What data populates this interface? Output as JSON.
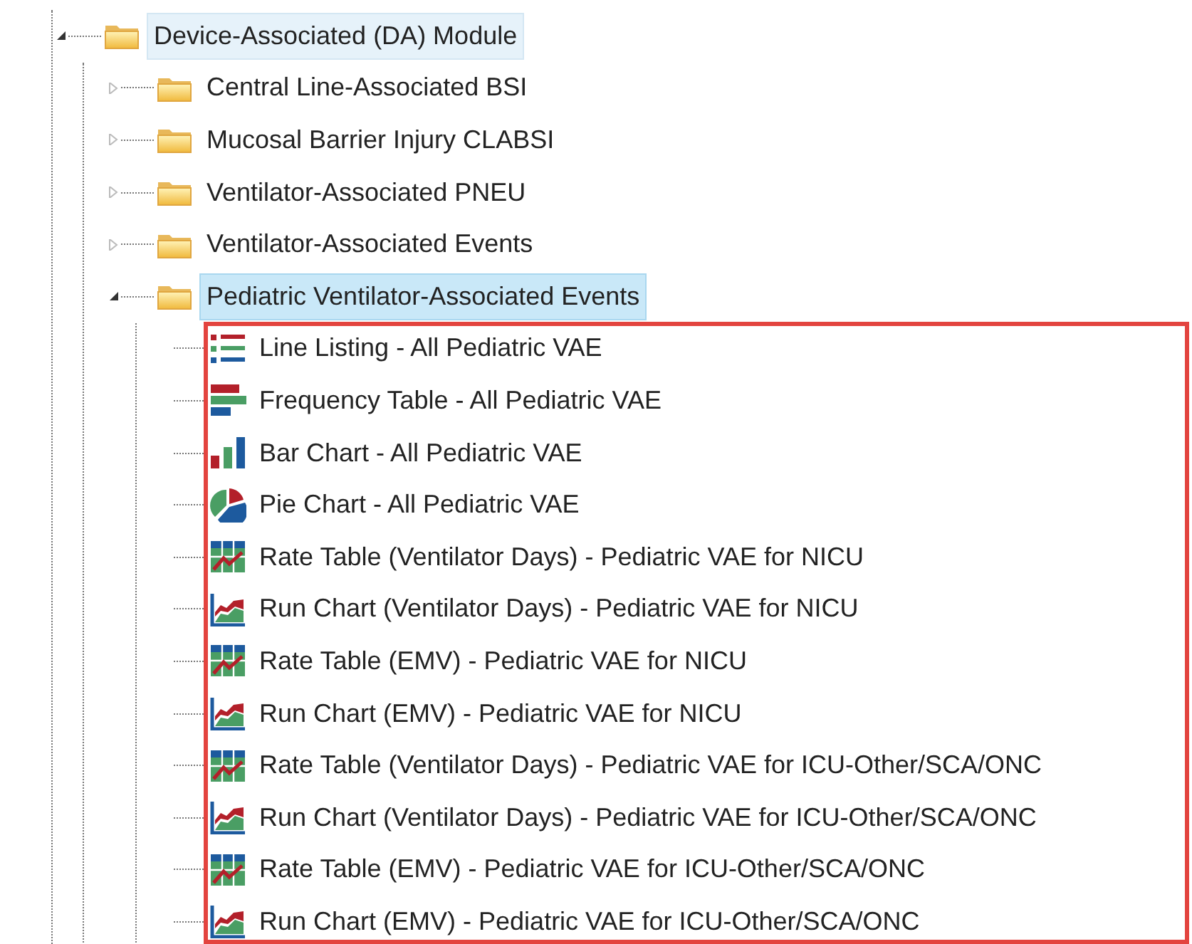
{
  "tree": [
    {
      "label": "Device-Associated (DA) Module",
      "kind": "folder",
      "expanded": true,
      "selected": false,
      "hovered": true,
      "children": [
        {
          "label": "Central Line-Associated BSI",
          "kind": "folder",
          "expanded": false,
          "selected": false,
          "hovered": false
        },
        {
          "label": "Mucosal Barrier Injury CLABSI",
          "kind": "folder",
          "expanded": false,
          "selected": false,
          "hovered": false
        },
        {
          "label": "Ventilator-Associated PNEU",
          "kind": "folder",
          "expanded": false,
          "selected": false,
          "hovered": false
        },
        {
          "label": "Ventilator-Associated Events",
          "kind": "folder",
          "expanded": false,
          "selected": false,
          "hovered": false
        },
        {
          "label": "Pediatric Ventilator-Associated Events",
          "kind": "folder",
          "expanded": true,
          "selected": true,
          "hovered": false,
          "outlined": true,
          "children": [
            {
              "label": "Line Listing - All Pediatric VAE",
              "kind": "listing"
            },
            {
              "label": "Frequency Table - All Pediatric VAE",
              "kind": "frequency"
            },
            {
              "label": "Bar Chart - All Pediatric VAE",
              "kind": "bar"
            },
            {
              "label": "Pie Chart - All Pediatric VAE",
              "kind": "pie"
            },
            {
              "label": "Rate Table (Ventilator Days) - Pediatric VAE for NICU",
              "kind": "rate"
            },
            {
              "label": "Run Chart (Ventilator Days) - Pediatric VAE for NICU",
              "kind": "run"
            },
            {
              "label": "Rate Table (EMV) - Pediatric VAE for NICU",
              "kind": "rate"
            },
            {
              "label": "Run Chart (EMV) - Pediatric VAE for NICU",
              "kind": "run"
            },
            {
              "label": "Rate Table (Ventilator Days) - Pediatric VAE for ICU-Other/SCA/ONC",
              "kind": "rate"
            },
            {
              "label": "Run Chart (Ventilator Days) - Pediatric VAE for ICU-Other/SCA/ONC",
              "kind": "run"
            },
            {
              "label": "Rate Table (EMV) - Pediatric VAE for ICU-Other/SCA/ONC",
              "kind": "rate"
            },
            {
              "label": "Run Chart (EMV) - Pediatric VAE for ICU-Other/SCA/ONC",
              "kind": "run"
            }
          ]
        }
      ]
    }
  ]
}
